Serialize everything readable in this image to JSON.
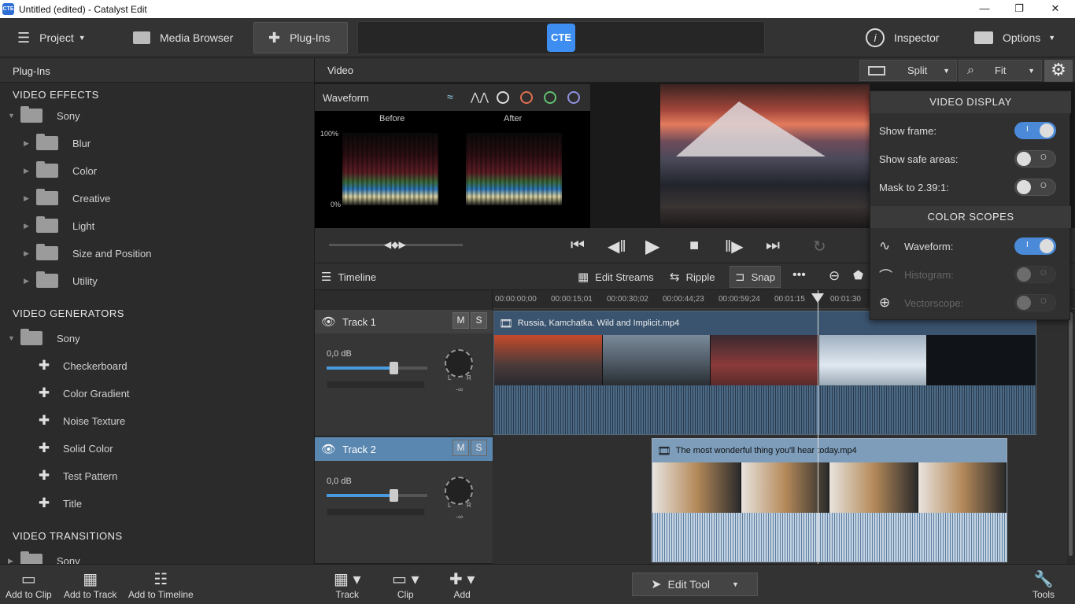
{
  "window": {
    "title": "Untitled (edited) - Catalyst Edit",
    "icon_text": "CTE",
    "minimize": "—",
    "restore": "❐",
    "close": "✕"
  },
  "mainbar": {
    "project": "Project",
    "media_browser": "Media Browser",
    "plugins": "Plug-Ins",
    "logo": "CTE",
    "inspector": "Inspector",
    "options": "Options"
  },
  "left": {
    "header": "Plug-Ins",
    "video_effects": "VIDEO EFFECTS",
    "effects_root": "Sony",
    "effects": [
      "Blur",
      "Color",
      "Creative",
      "Light",
      "Size and Position",
      "Utility"
    ],
    "video_generators": "VIDEO GENERATORS",
    "generators_root": "Sony",
    "generators": [
      "Checkerboard",
      "Color Gradient",
      "Noise Texture",
      "Solid Color",
      "Test Pattern",
      "Title"
    ],
    "video_transitions": "VIDEO TRANSITIONS",
    "transitions_root": "Sony"
  },
  "bottom_left": {
    "add_clip": "Add to Clip",
    "add_track": "Add to Track",
    "add_timeline": "Add to Timeline"
  },
  "video": {
    "label": "Video",
    "split": "Split",
    "fit": "Fit"
  },
  "waveform": {
    "title": "Waveform",
    "before": "Before",
    "after": "After",
    "top": "100%",
    "bottom": "0%"
  },
  "timeline": {
    "label": "Timeline",
    "edit_streams": "Edit Streams",
    "ripple": "Ripple",
    "snap": "Snap",
    "more": "•••",
    "ticks": [
      "00:00:00;00",
      "00:00:15;01",
      "00:00:30;02",
      "00:00:44;23",
      "00:00:59;24",
      "00:01:15",
      "00:01:30"
    ]
  },
  "tracks": [
    {
      "name": "Track 1",
      "m": "M",
      "s": "S",
      "db": "0,0 dB",
      "l": "L",
      "r": "R",
      "inf": "-∞",
      "clip": "Russia, Kamchatka. Wild and Implicit.mp4"
    },
    {
      "name": "Track 2",
      "m": "M",
      "s": "S",
      "db": "0,0 dB",
      "l": "L",
      "r": "R",
      "inf": "-∞",
      "clip": "The most wonderful thing you'll hear today.mp4"
    }
  ],
  "popup": {
    "video_display": "VIDEO DISPLAY",
    "show_frame": "Show frame:",
    "show_safe": "Show safe areas:",
    "mask": "Mask to 2.39:1:",
    "color_scopes": "COLOR SCOPES",
    "waveform": "Waveform:",
    "histogram": "Histogram:",
    "vectorscope": "Vectorscope:",
    "toggle_on": "I",
    "toggle_off": "O"
  },
  "bottom_right": {
    "track": "Track",
    "clip": "Clip",
    "add": "Add",
    "edit_tool": "Edit Tool",
    "tools": "Tools"
  }
}
